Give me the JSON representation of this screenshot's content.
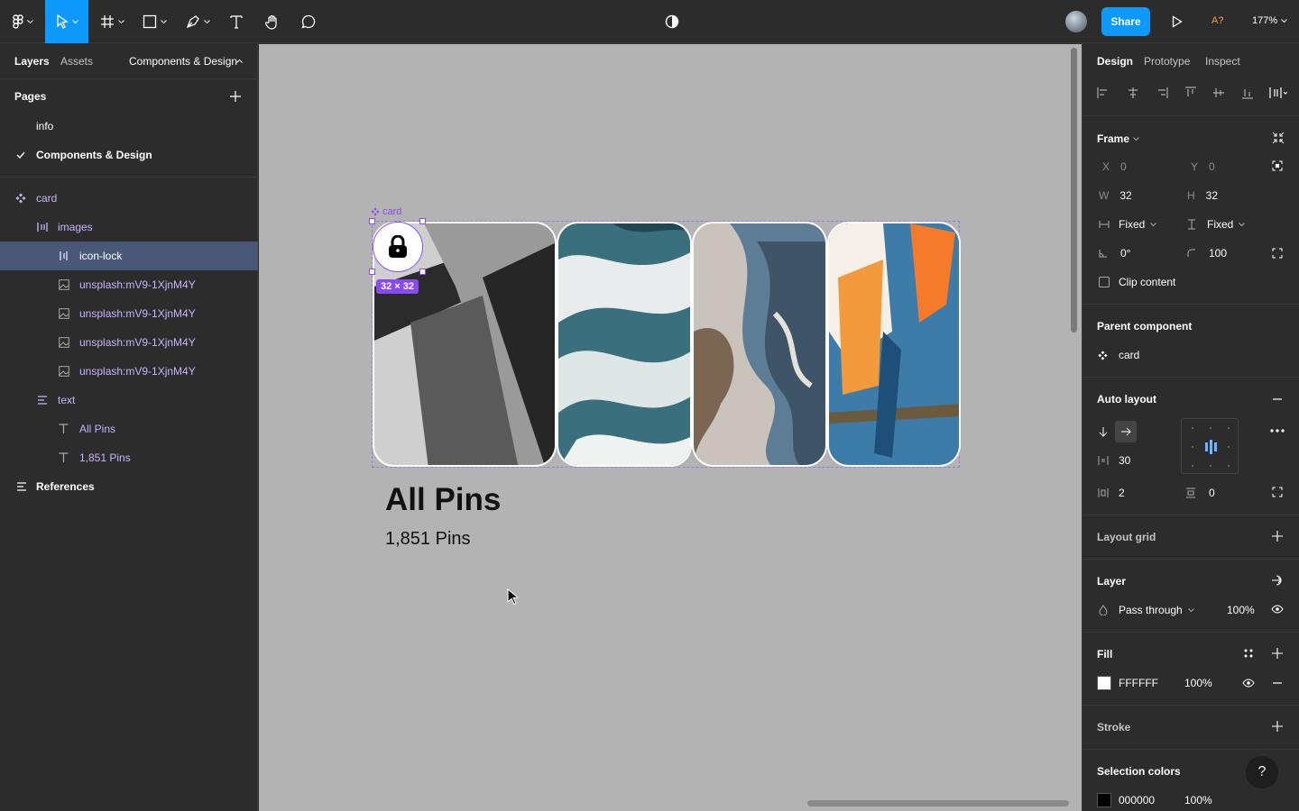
{
  "toolbar": {
    "share_label": "Share",
    "access_label": "A?",
    "zoom_label": "177%"
  },
  "left_panel": {
    "tabs": {
      "layers": "Layers",
      "assets": "Assets",
      "page_switch": "Components & Design"
    },
    "pages_title": "Pages",
    "pages": [
      {
        "label": "info"
      },
      {
        "label": "Components & Design"
      }
    ],
    "layers": [
      {
        "label": "card"
      },
      {
        "label": "images"
      },
      {
        "label": "icon-lock"
      },
      {
        "label": "unsplash:mV9-1XjnM4Y"
      },
      {
        "label": "unsplash:mV9-1XjnM4Y"
      },
      {
        "label": "unsplash:mV9-1XjnM4Y"
      },
      {
        "label": "unsplash:mV9-1XjnM4Y"
      },
      {
        "label": "text"
      },
      {
        "label": "All Pins"
      },
      {
        "label": "1,851 Pins"
      }
    ],
    "references": "References"
  },
  "canvas": {
    "selection_label": "card",
    "size_badge": "32 × 32",
    "card_title": "All Pins",
    "card_subtitle": "1,851 Pins"
  },
  "right_panel": {
    "tabs": {
      "design": "Design",
      "prototype": "Prototype",
      "inspect": "Inspect"
    },
    "frame": {
      "title": "Frame",
      "x_label": "X",
      "x": "0",
      "y_label": "Y",
      "y": "0",
      "w_label": "W",
      "w": "32",
      "h_label": "H",
      "h": "32",
      "w_mode": "Fixed",
      "h_mode": "Fixed",
      "rotation": "0°",
      "radius": "100",
      "clip": "Clip content"
    },
    "parent": {
      "title": "Parent component",
      "name": "card"
    },
    "auto_layout": {
      "title": "Auto layout",
      "spacing": "30",
      "padding_h": "2",
      "padding_v": "0"
    },
    "layout_grid": {
      "title": "Layout grid"
    },
    "layer": {
      "title": "Layer",
      "blend": "Pass through",
      "opacity": "100%"
    },
    "fill": {
      "title": "Fill",
      "hex": "FFFFFF",
      "opacity": "100%",
      "color": "#FFFFFF"
    },
    "stroke": {
      "title": "Stroke"
    },
    "selection_colors": {
      "title": "Selection colors",
      "hex": "000000",
      "opacity": "100%",
      "color": "#000000"
    },
    "help": "?"
  }
}
